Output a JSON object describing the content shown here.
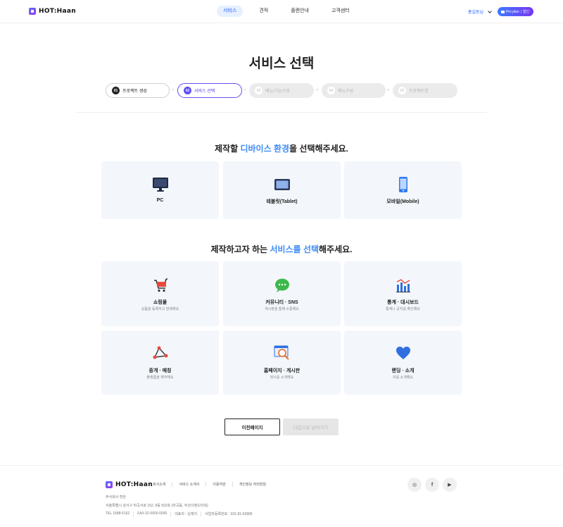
{
  "header": {
    "logo_text": "HOT:Haan",
    "nav": [
      {
        "label": "서비스",
        "active": true
      },
      {
        "label": "견적",
        "active": false
      },
      {
        "label": "플랜안내",
        "active": false
      },
      {
        "label": "고객센터",
        "active": false
      }
    ],
    "user_name": "홍길동님",
    "plan_label": "Pro plan",
    "plan_action": "알긴"
  },
  "page_title": "서비스 선택",
  "steps": [
    {
      "num": "01",
      "label": "프로젝트 생성",
      "state": "done"
    },
    {
      "num": "02",
      "label": "서비스 선택",
      "state": "active"
    },
    {
      "num": "03",
      "label": "메뉴/기능구성",
      "state": "pending"
    },
    {
      "num": "04",
      "label": "메뉴구성",
      "state": "pending"
    },
    {
      "num": "05",
      "label": "프로젝트명",
      "state": "pending"
    }
  ],
  "step_separator": "»",
  "device_section": {
    "title_before": "제작할 ",
    "title_highlight": "디바이스 환경",
    "title_after": "을 선택해주세요.",
    "options": [
      {
        "label": "PC",
        "icon": "monitor-icon"
      },
      {
        "label": "테블릿(Tablet)",
        "icon": "tablet-icon"
      },
      {
        "label": "모바일(Mobile)",
        "icon": "mobile-icon"
      }
    ]
  },
  "service_section": {
    "title_before": "제작하고자 하는 ",
    "title_highlight": "서비스를 선택",
    "title_after": "해주세요.",
    "options": [
      {
        "label": "쇼핑몰",
        "desc": "상품을 등록하고 판매해요",
        "icon": "cart-icon"
      },
      {
        "label": "커뮤니티 · SNS",
        "desc": "게시판을 통해 소통해요",
        "icon": "chat-icon"
      },
      {
        "label": "통계 · 대시보드",
        "desc": "통계나 공지를 확인해요",
        "icon": "bar-chart-icon"
      },
      {
        "label": "중개 · 매칭",
        "desc": "플랫폼을 제작해요",
        "icon": "network-icon"
      },
      {
        "label": "홈페이지 · 게시판",
        "desc": "회사를 소개해요",
        "icon": "browser-search-icon"
      },
      {
        "label": "랜딩 · 소개",
        "desc": "저를 소개해요",
        "icon": "heart-icon"
      }
    ]
  },
  "buttons": {
    "prev": "이전페이지",
    "next": "다음으로 넘어가기"
  },
  "footer": {
    "logo_text": "HOT:Haan",
    "links": [
      "회사소개",
      "서비스 소개서",
      "이용약관",
      "개인정보 처리방침"
    ],
    "company": "주식회사 핫한",
    "address": "서울특별시 강서구 마곡서로 152, 8동 502호 (마곡동, 두산더랜드타워)",
    "contacts": [
      "TEL 1588-5162",
      "FAX 02-0000-0000",
      "대표자 : 김재지",
      "사업자등록번호 : 331-81-02895"
    ],
    "social": [
      {
        "name": "instagram",
        "glyph": "◎"
      },
      {
        "name": "facebook",
        "glyph": "f"
      },
      {
        "name": "youtube",
        "glyph": "▶"
      }
    ]
  },
  "colors": {
    "accent_blue": "#3f8cf6",
    "accent_purple": "#5b4cf6",
    "card_bg": "#f3f6fb"
  }
}
